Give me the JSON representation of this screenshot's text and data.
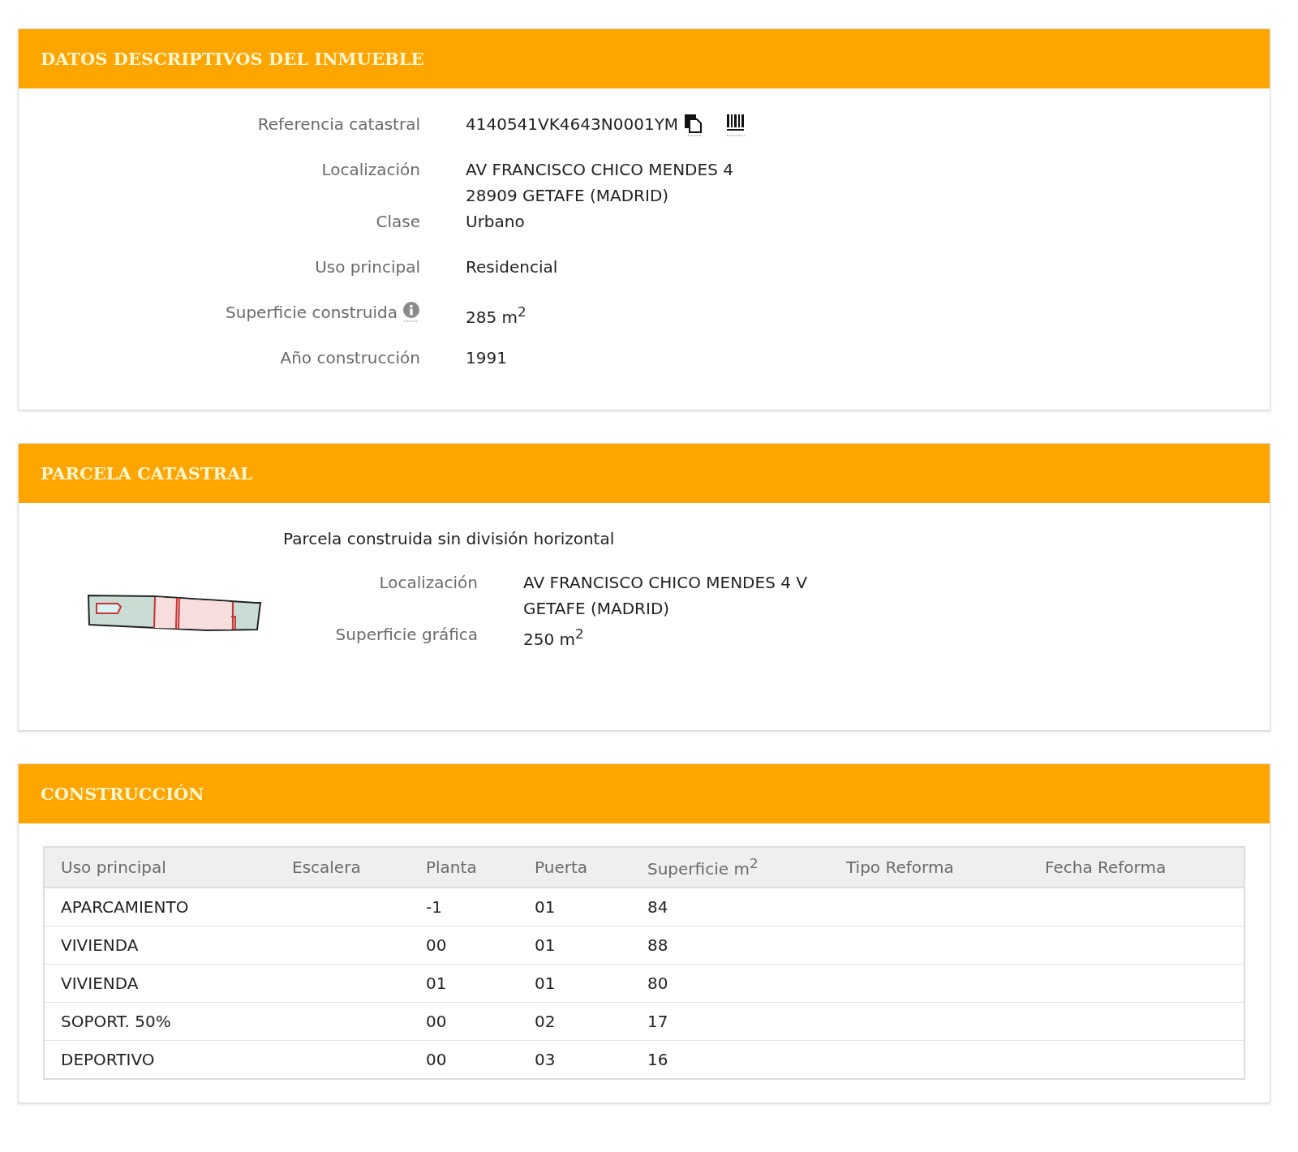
{
  "property": {
    "title": "DATOS DESCRIPTIVOS DEL INMUEBLE",
    "fields": [
      {
        "label": "Referencia catastral",
        "lines": [
          "4140541VK4643N0001YM"
        ],
        "kind": "reference"
      },
      {
        "label": "Localización",
        "lines": [
          "AV FRANCISCO CHICO MENDES 4",
          "28909 GETAFE (MADRID)"
        ],
        "kind": "plain"
      },
      {
        "label": "Clase",
        "lines": [
          "Urbano"
        ],
        "kind": "plain"
      },
      {
        "label": "Uso principal",
        "lines": [
          "Residencial"
        ],
        "kind": "plain"
      },
      {
        "label": "Superficie construida",
        "lines": [
          "285 m$^{2}$"
        ],
        "kind": "info"
      },
      {
        "label": "Año construcción",
        "lines": [
          "1991"
        ],
        "kind": "plain"
      }
    ]
  },
  "parcel": {
    "title": "PARCELA CATASTRAL",
    "subtitle": "Parcela construida sin división horizontal",
    "fields": [
      {
        "label": "Localización",
        "lines": [
          "AV FRANCISCO CHICO MENDES 4 V",
          "GETAFE (MADRID)"
        ]
      },
      {
        "label": "Superficie gráfica",
        "lines": [
          "250 m$^{2}$"
        ]
      }
    ]
  },
  "construction": {
    "title": "CONSTRUCCIÓN",
    "columns": [
      "Uso principal",
      "Escalera",
      "Planta",
      "Puerta",
      "Superficie m$^{2}$",
      "Tipo Reforma",
      "Fecha Reforma"
    ],
    "rows": [
      {
        "uso_principal": "APARCAMIENTO",
        "planta": "-1",
        "puerta": "01",
        "superficie": "84"
      },
      {
        "uso_principal": "VIVIENDA",
        "planta": "00",
        "puerta": "01",
        "superficie": "88"
      },
      {
        "uso_principal": "VIVIENDA",
        "planta": "01",
        "puerta": "01",
        "superficie": "80"
      },
      {
        "uso_principal": "SOPORT. 50%",
        "planta": "00",
        "puerta": "02",
        "superficie": "17"
      },
      {
        "uso_principal": "DEPORTIVO",
        "planta": "00",
        "puerta": "03",
        "superficie": "16"
      }
    ]
  }
}
